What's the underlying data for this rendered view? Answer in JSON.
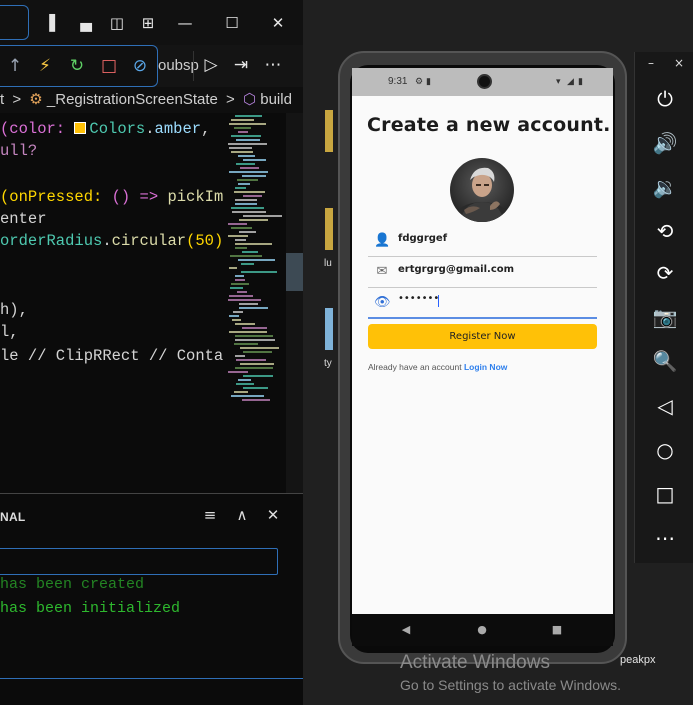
{
  "ide": {
    "debug_tab_partial": "oubsp",
    "breadcrumb": {
      "item1": "t",
      "sep": ">",
      "class_name": "_RegistrationScreenState",
      "method": "build"
    },
    "code": {
      "l1_a": "(color: ",
      "l1_b": "Colors",
      "l1_c": ".",
      "l1_d": "amber",
      "l1_e": ",",
      "l2_a": "ull",
      "l2_b": "?",
      "l3_a": "(onPressed: ",
      "l3_b": "() => ",
      "l3_c": "pickIm",
      "l4": "enter",
      "l5_a": "orderRadius",
      "l5_b": ".",
      "l5_c": "circular",
      "l5_d": "(50)",
      "l6": "h),",
      "l7": "l,",
      "l8": "le // ClipRRect // Conta"
    },
    "panel": {
      "title": "NAL",
      "term_line1": "has been created",
      "term_line2": "has been initialized"
    }
  },
  "app": {
    "status_time": "9:31",
    "title": "Create a new account.",
    "fields": {
      "name_value": "fdggrgef",
      "email_value": "ertgrgrg@gmail.com",
      "password_value": "•••••••"
    },
    "register_button": "Register Now",
    "login_prompt": "Already have an account",
    "login_link": "Login Now"
  },
  "desktop": {
    "watermark_title": "Activate Windows",
    "watermark_sub": "Go to Settings to activate Windows.",
    "label_fragment": "peakpx",
    "side_labels": [
      "lu",
      "ty"
    ]
  },
  "colors": {
    "accent_button": "#ffc107",
    "link": "#2f80ed",
    "focus_underline": "#5b8de3",
    "terminal_green": "#2eb82e"
  }
}
